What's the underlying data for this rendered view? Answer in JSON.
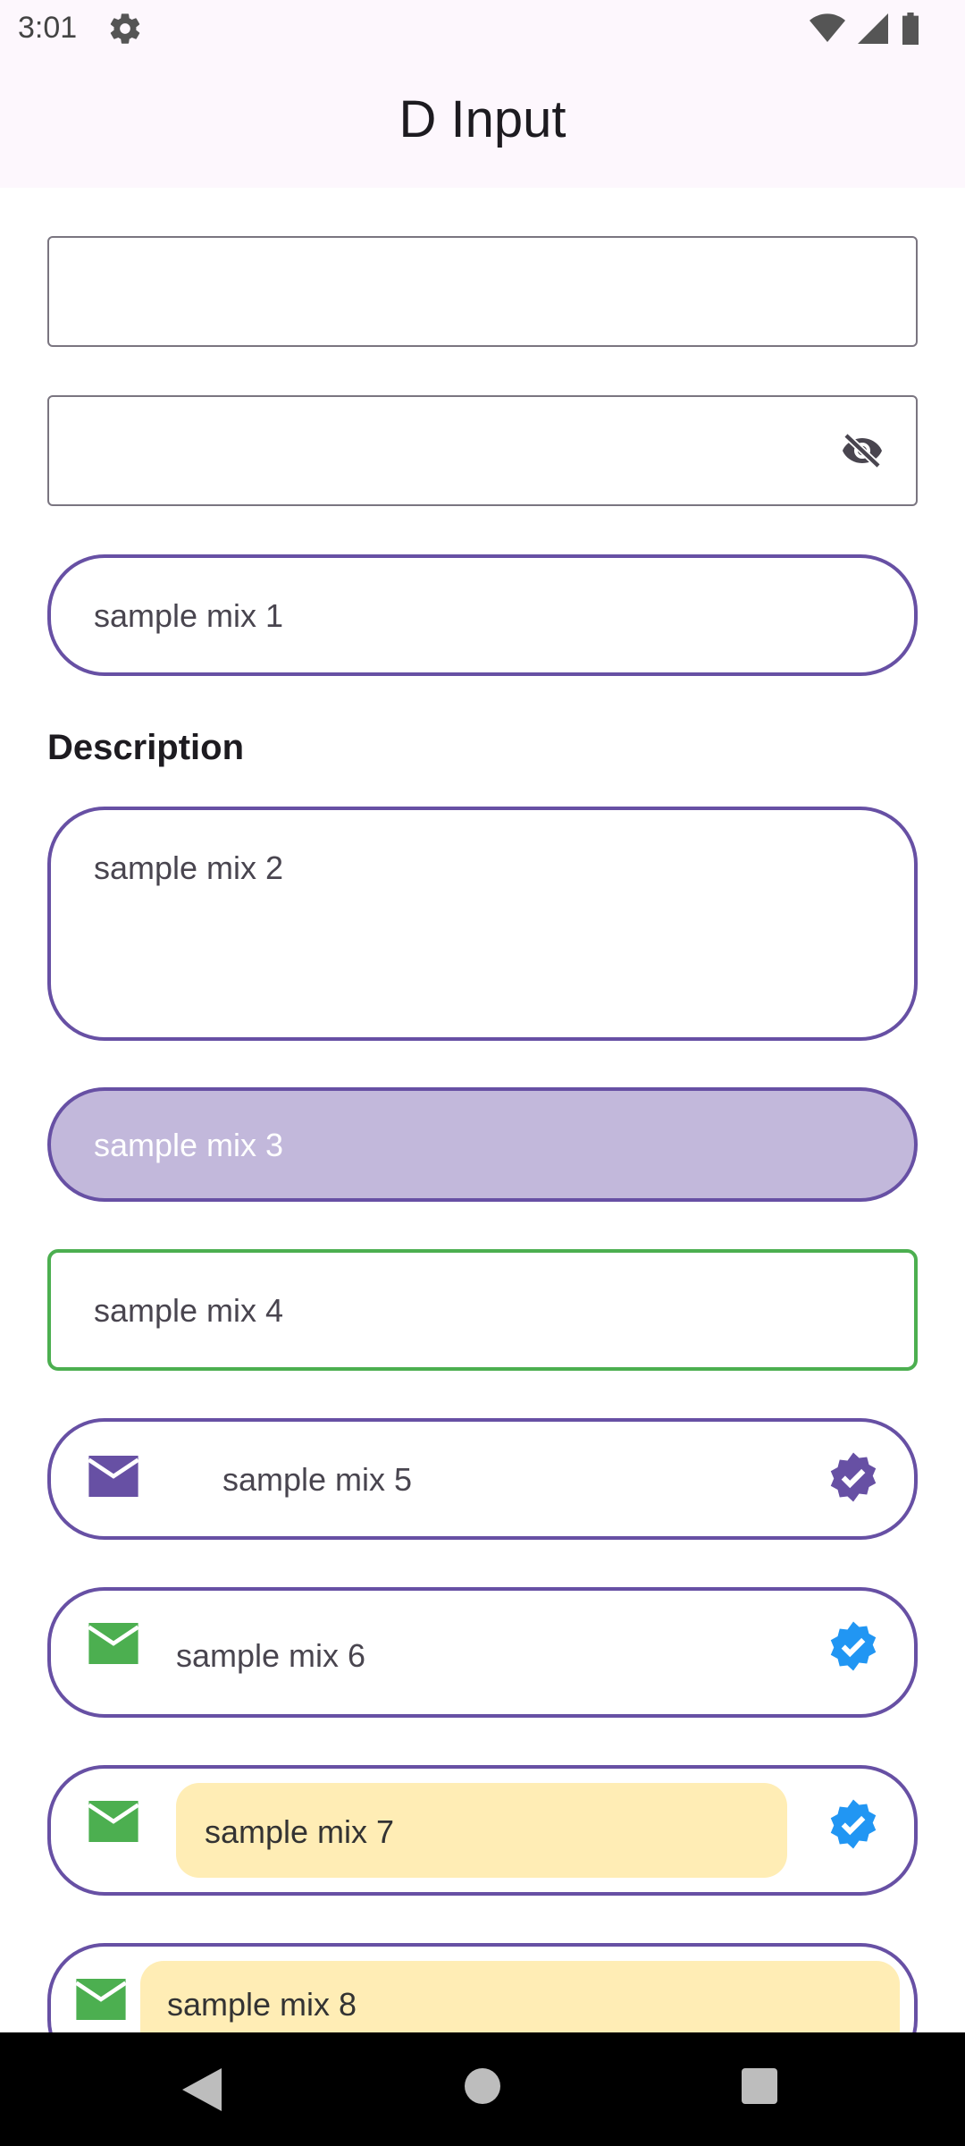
{
  "status_bar": {
    "time": "3:01"
  },
  "app_bar": {
    "title": "D Input"
  },
  "fields": {
    "plain_input": {
      "value": ""
    },
    "password_input": {
      "value": ""
    },
    "mix1": {
      "value": "sample mix 1"
    },
    "description_label": "Description",
    "mix2": {
      "value": "sample mix 2"
    },
    "mix3": {
      "value": "sample mix 3"
    },
    "mix4": {
      "value": "sample mix 4"
    },
    "mix5": {
      "value": "sample mix 5"
    },
    "mix6": {
      "value": "sample mix 6"
    },
    "mix7": {
      "value": "sample mix 7"
    },
    "mix8": {
      "value": "sample mix 8"
    }
  },
  "colors": {
    "accent": "#6750a4",
    "filled": "#c2b8db",
    "success": "#4caf50",
    "verified_blue": "#2196f3",
    "highlight": "#ffedb5"
  },
  "icons": {
    "visibility_toggle": "eye-off-icon",
    "prefix": "mail-icon",
    "suffix": "verified-icon"
  }
}
